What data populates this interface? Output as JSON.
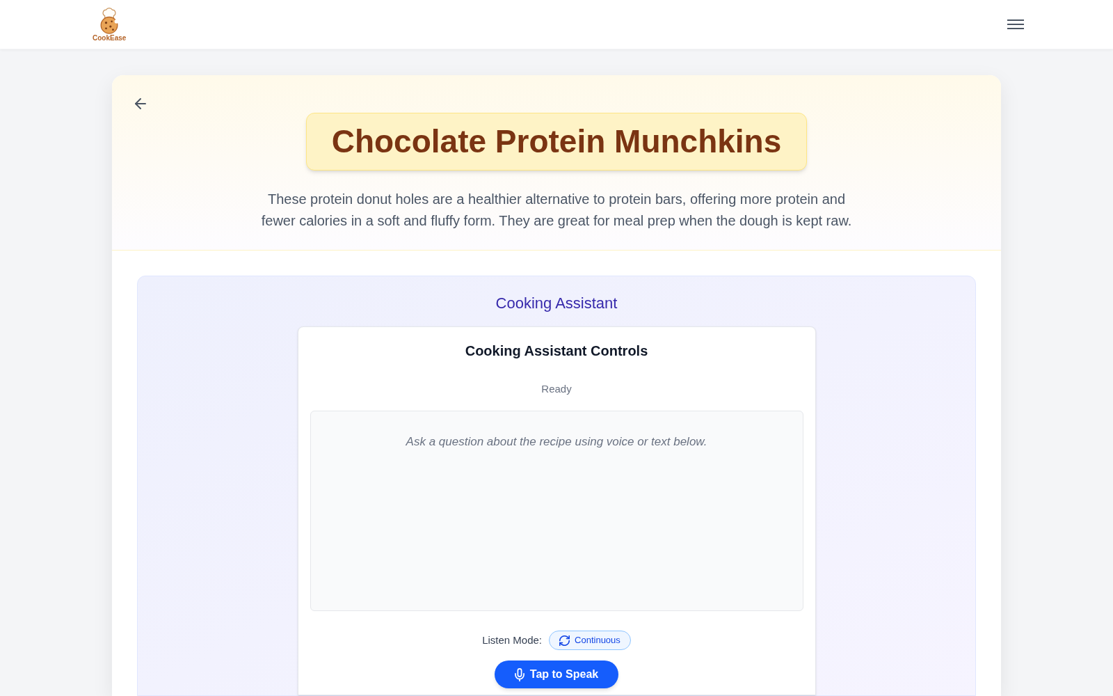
{
  "header": {
    "logo_text": "CookEase"
  },
  "recipe": {
    "title": "Chocolate Protein Munchkins",
    "description": "These protein donut holes are a healthier alternative to protein bars, offering more protein and fewer calories in a soft and fluffy form. They are great for meal prep when the dough is kept raw."
  },
  "assistant": {
    "heading": "Cooking Assistant",
    "controls": {
      "title": "Cooking Assistant Controls",
      "status": "Ready",
      "conversation": {
        "empty_message": "Ask a question about the recipe using voice or text below."
      },
      "listen_mode": {
        "label": "Listen Mode:",
        "value": "Continuous"
      },
      "speak_button": "Tap to Speak"
    }
  }
}
